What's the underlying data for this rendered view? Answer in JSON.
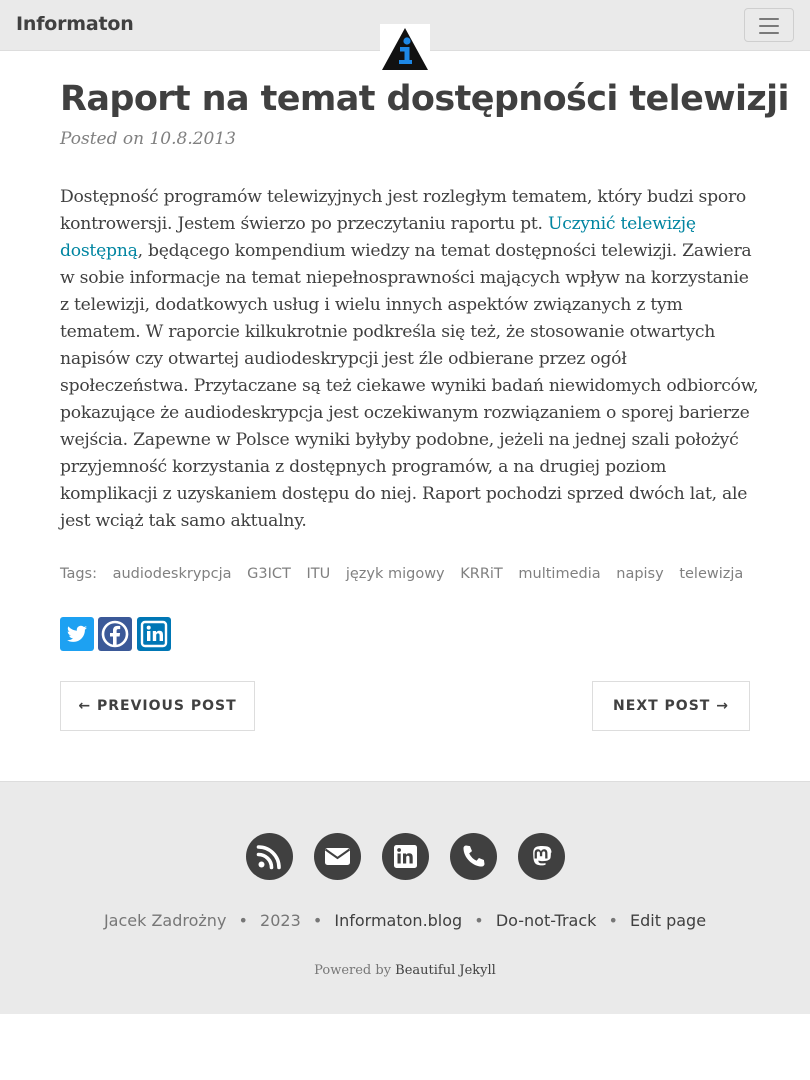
{
  "nav": {
    "brand": "Informaton",
    "logo_icon": "information-triangle-icon",
    "menu_icon": "hamburger-menu-icon"
  },
  "post": {
    "title": "Raport na temat dostępności telewizji",
    "meta": "Posted on 10.8.2013",
    "body_lines": [
      "Dostępność programów telewizyjnych jest rozległym tematem, który budzi sporo",
      "kontrowersji. Jestem świerzo po przeczytaniu raportu pt. ",
      "Uczynić telewizję",
      "dostępną",
      ", będącego kompendium wiedzy na temat dostępności telewizji. Zawiera",
      "w sobie informacje na temat niepełnosprawności mających wpływ na korzystanie",
      "z telewizji, dodatkowych usług i wielu innych aspektów związanych z tym",
      "tematem. W raporcie kilkukrotnie podkreśla się też, że stosowanie otwartych",
      "napisów czy otwartej audiodeskrypcji jest źle odbierane przez ogół",
      "społeczeństwa. Przytaczane są też ciekawe wyniki badań niewidomych odbiorców,",
      "pokazujące że audiodeskrypcja jest oczekiwanym rozwiązaniem o sporej barierze",
      "wejścia. Zapewne w Polsce wyniki byłyby podobne, jeżeli na jednej szali położyć",
      "przyjemność korzystania z dostępnych programów, a na drugiej poziom",
      "komplikacji z uzyskaniem dostępu do niej. Raport pochodzi sprzed dwóch lat, ale",
      "jest wciąż tak samo aktualny."
    ],
    "tags_label": "Tags:",
    "tags": [
      "audiodeskrypcja",
      "G3ICT",
      "ITU",
      "język migowy",
      "KRRiT",
      "multimedia",
      "napisy",
      "telewizja"
    ]
  },
  "share": {
    "icons": [
      "twitter-icon",
      "facebook-icon",
      "linkedin-icon"
    ],
    "colors": {
      "twitter": "#1da1f2",
      "facebook": "#3b5998",
      "linkedin": "#0077b5"
    }
  },
  "pager": {
    "prev": "← PREVIOUS POST",
    "next": "NEXT POST →"
  },
  "footer": {
    "icons": [
      "rss-icon",
      "envelope-icon",
      "linkedin-icon",
      "phone-icon",
      "mastodon-icon"
    ],
    "author": "Jacek Zadrożny",
    "year": "2023",
    "site": "Informaton.blog",
    "dnt": "Do-not-Track",
    "edit": "Edit page",
    "bullet": "•",
    "powered_prefix": "Powered by ",
    "powered_link": "Beautiful Jekyll"
  },
  "colors": {
    "navbar_bg": "#eaeaea",
    "text": "#404040",
    "link": "#0085a1",
    "muted": "#808080",
    "logo_blue": "#1e88e5"
  }
}
